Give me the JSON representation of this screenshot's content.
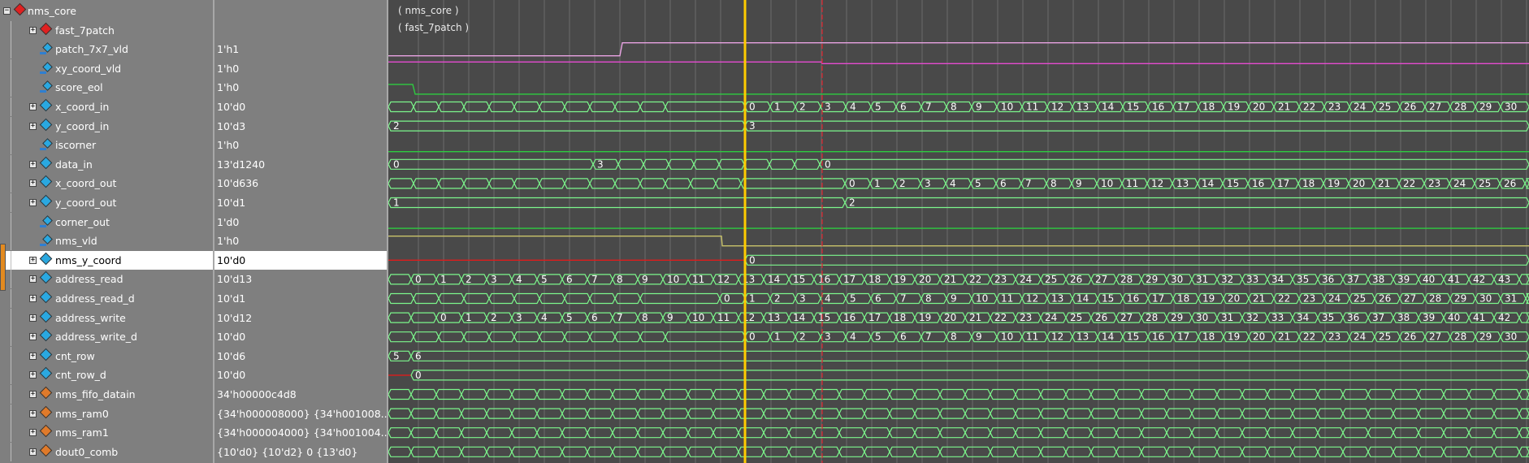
{
  "colors": {
    "bus": "#7CF78C",
    "scalar_green": "#2ecc40",
    "pink": "#e9a3e3",
    "magenta": "#e64bd1",
    "yellow_line": "#c9c36a",
    "red": "#e01b1b",
    "cursor_yellow": "#ffcc00",
    "cursor_red": "#e0202a"
  },
  "waveform": {
    "scope_labels": [
      "( nms_core )",
      "( fast_7patch )"
    ],
    "signals": [
      {
        "name": "nms_core",
        "value": "",
        "icon": "red-gem-icon",
        "expander": "minus",
        "indent": 0,
        "kind": "scope"
      },
      {
        "name": "fast_7patch",
        "value": "",
        "icon": "red-gem-icon",
        "expander": "plus",
        "indent": 1,
        "kind": "scope"
      },
      {
        "name": "patch_7x7_vld",
        "value": "1'h1",
        "icon": "cyan-wire-icon",
        "expander": "",
        "indent": 1,
        "kind": "scalar",
        "color": "#e9a3e3",
        "transitions": [
          0,
          1
        ],
        "levels": [
          0,
          1
        ]
      },
      {
        "name": "xy_coord_vld",
        "value": "1'h0",
        "icon": "cyan-wire-icon",
        "expander": "",
        "indent": 1,
        "kind": "scalar",
        "color": "#e64bd1",
        "levels": [
          1,
          0
        ]
      },
      {
        "name": "score_eol",
        "value": "1'h0",
        "icon": "cyan-wire-icon",
        "expander": "",
        "indent": 1,
        "kind": "scalar",
        "color": "#2ecc40"
      },
      {
        "name": "x_coord_in",
        "value": "10'd0",
        "icon": "cyan-gem-icon",
        "expander": "plus",
        "indent": 1,
        "kind": "bus",
        "labels": [
          "0",
          "1",
          "2",
          "3",
          "4",
          "5",
          "6",
          "7",
          "8",
          "9",
          "10",
          "11",
          "12",
          "13",
          "14",
          "15",
          "16",
          "17",
          "18",
          "19",
          "20",
          "21",
          "22",
          "23",
          "24",
          "25",
          "26",
          "27",
          "28",
          "29",
          "30"
        ]
      },
      {
        "name": "y_coord_in",
        "value": "10'd3",
        "icon": "cyan-gem-icon",
        "expander": "plus",
        "indent": 1,
        "kind": "bus",
        "labels": [
          "2",
          "3"
        ]
      },
      {
        "name": "iscorner",
        "value": "1'h0",
        "icon": "cyan-wire-icon",
        "expander": "",
        "indent": 1,
        "kind": "scalar",
        "color": "#2ecc40"
      },
      {
        "name": "data_in",
        "value": "13'd1240",
        "icon": "cyan-gem-icon",
        "expander": "plus",
        "indent": 1,
        "kind": "bus",
        "labels": [
          "0",
          "3",
          "0"
        ]
      },
      {
        "name": "x_coord_out",
        "value": "10'd636",
        "icon": "cyan-gem-icon",
        "expander": "plus",
        "indent": 1,
        "kind": "bus",
        "labels": [
          "0",
          "1",
          "2",
          "3",
          "4",
          "5",
          "6",
          "7",
          "8",
          "9",
          "10",
          "11",
          "12",
          "13",
          "14",
          "15",
          "16",
          "17",
          "18",
          "19",
          "20",
          "21",
          "22",
          "23",
          "24",
          "25",
          "26"
        ]
      },
      {
        "name": "y_coord_out",
        "value": "10'd1",
        "icon": "cyan-gem-icon",
        "expander": "plus",
        "indent": 1,
        "kind": "bus",
        "labels": [
          "1",
          "2"
        ]
      },
      {
        "name": "corner_out",
        "value": "1'd0",
        "icon": "cyan-wire-icon",
        "expander": "",
        "indent": 1,
        "kind": "scalar",
        "color": "#2ecc40"
      },
      {
        "name": "nms_vld",
        "value": "1'h0",
        "icon": "cyan-wire-icon",
        "expander": "",
        "indent": 1,
        "kind": "scalar",
        "color": "#c9c36a"
      },
      {
        "name": "nms_y_coord",
        "value": "10'd0",
        "icon": "cyan-gem-icon",
        "expander": "plus",
        "indent": 1,
        "kind": "bus",
        "selected": true,
        "labels": [
          "0"
        ]
      },
      {
        "name": "address_read",
        "value": "10'd13",
        "icon": "cyan-gem-icon",
        "expander": "plus",
        "indent": 1,
        "kind": "bus",
        "labels": [
          "0",
          "1",
          "2",
          "3",
          "4",
          "5",
          "6",
          "7",
          "8",
          "9",
          "10",
          "11",
          "12",
          "13",
          "14",
          "15",
          "16",
          "17",
          "18",
          "19",
          "20",
          "21",
          "22",
          "23",
          "24",
          "25",
          "26",
          "27",
          "28",
          "29",
          "30",
          "31",
          "32",
          "33",
          "34",
          "35",
          "36",
          "37",
          "38",
          "39",
          "40",
          "41",
          "42",
          "43"
        ]
      },
      {
        "name": "address_read_d",
        "value": "10'd1",
        "icon": "cyan-gem-icon",
        "expander": "plus",
        "indent": 1,
        "kind": "bus",
        "labels": [
          "0",
          "1",
          "2",
          "3",
          "4",
          "5",
          "6",
          "7",
          "8",
          "9",
          "10",
          "11",
          "12",
          "13",
          "14",
          "15",
          "16",
          "17",
          "18",
          "19",
          "20",
          "21",
          "22",
          "23",
          "24",
          "25",
          "26",
          "27",
          "28",
          "29",
          "30",
          "31"
        ]
      },
      {
        "name": "address_write",
        "value": "10'd12",
        "icon": "cyan-gem-icon",
        "expander": "plus",
        "indent": 1,
        "kind": "bus",
        "labels": [
          "0",
          "1",
          "2",
          "3",
          "4",
          "5",
          "6",
          "7",
          "8",
          "9",
          "10",
          "11",
          "12",
          "13",
          "14",
          "15",
          "16",
          "17",
          "18",
          "19",
          "20",
          "21",
          "22",
          "23",
          "24",
          "25",
          "26",
          "27",
          "28",
          "29",
          "30",
          "31",
          "32",
          "33",
          "34",
          "35",
          "36",
          "37",
          "38",
          "39",
          "40",
          "41",
          "42"
        ]
      },
      {
        "name": "address_write_d",
        "value": "10'd0",
        "icon": "cyan-gem-icon",
        "expander": "plus",
        "indent": 1,
        "kind": "bus",
        "labels": [
          "0",
          "1",
          "2",
          "3",
          "4",
          "5",
          "6",
          "7",
          "8",
          "9",
          "10",
          "11",
          "12",
          "13",
          "14",
          "15",
          "16",
          "17",
          "18",
          "19",
          "20",
          "21",
          "22",
          "23",
          "24",
          "25",
          "26",
          "27",
          "28",
          "29",
          "30"
        ]
      },
      {
        "name": "cnt_row",
        "value": "10'd6",
        "icon": "cyan-gem-icon",
        "expander": "plus",
        "indent": 1,
        "kind": "bus",
        "labels": [
          "5",
          "6"
        ]
      },
      {
        "name": "cnt_row_d",
        "value": "10'd0",
        "icon": "cyan-gem-icon",
        "expander": "plus",
        "indent": 1,
        "kind": "bus",
        "labels": [
          "0"
        ]
      },
      {
        "name": "nms_fifo_datain",
        "value": "34'h00000c4d8",
        "icon": "orange-gem-icon",
        "expander": "plus",
        "indent": 1,
        "kind": "bus",
        "labels": []
      },
      {
        "name": "nms_ram0",
        "value": "{34'h000008000} {34'h001008...",
        "icon": "orange-gem-icon",
        "expander": "plus",
        "indent": 1,
        "kind": "bus",
        "labels": []
      },
      {
        "name": "nms_ram1",
        "value": "{34'h000004000} {34'h001004...",
        "icon": "orange-gem-icon",
        "expander": "plus",
        "indent": 1,
        "kind": "bus",
        "labels": []
      },
      {
        "name": "dout0_comb",
        "value": "{10'd0} {10'd2} 0 {13'd0}",
        "icon": "orange-gem-icon",
        "expander": "plus",
        "indent": 1,
        "kind": "bus",
        "labels": []
      }
    ]
  }
}
